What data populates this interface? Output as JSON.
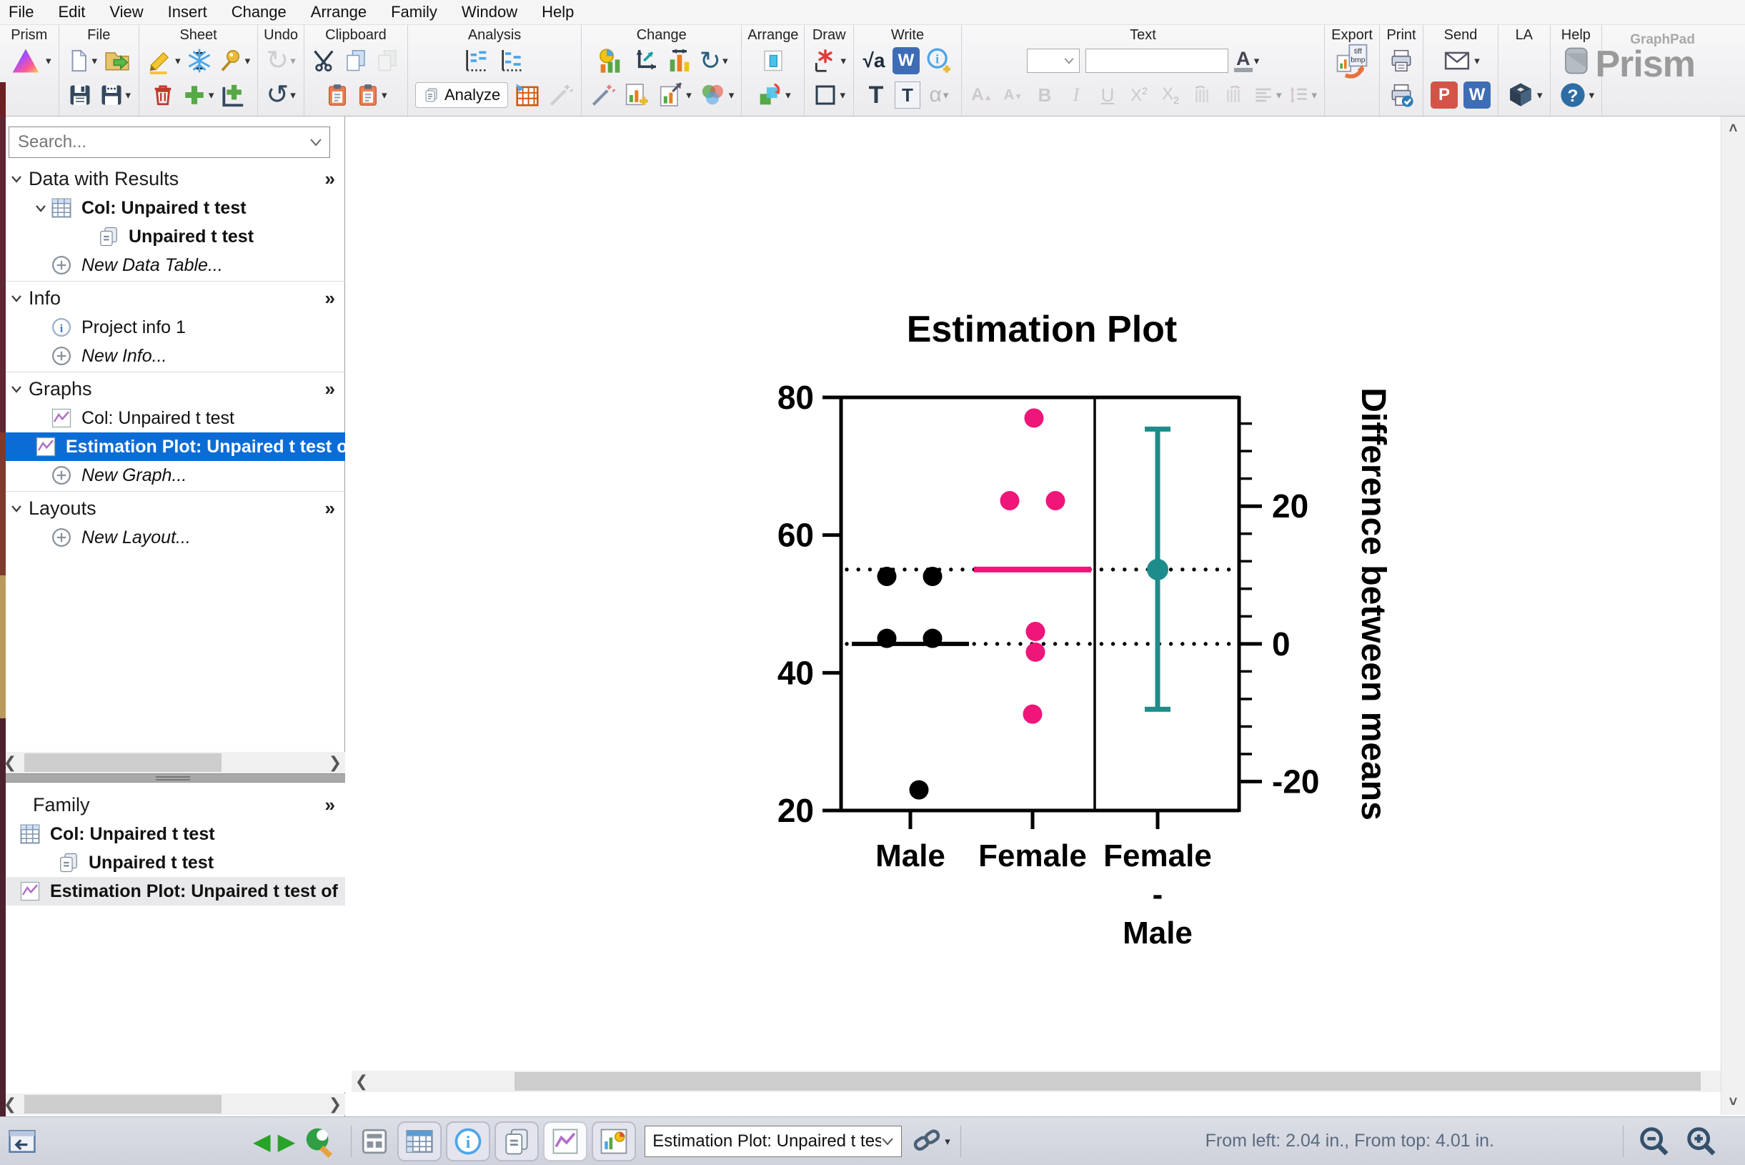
{
  "menu": {
    "items": [
      "File",
      "Edit",
      "View",
      "Insert",
      "Change",
      "Arrange",
      "Family",
      "Window",
      "Help"
    ]
  },
  "toolbar": {
    "sections": [
      {
        "label": "Prism",
        "rows": [
          [
            {
              "k": "prism",
              "n": "prism-logo-icon",
              "dd": 1
            }
          ]
        ]
      },
      {
        "label": "File",
        "rows": [
          [
            {
              "k": "doc",
              "n": "new-file-icon",
              "dd": 1
            },
            {
              "k": "folder",
              "n": "open-file-icon"
            }
          ],
          [
            {
              "k": "disk",
              "n": "save-icon"
            },
            {
              "k": "disk2",
              "n": "save-as-icon",
              "dd": 1
            }
          ]
        ]
      },
      {
        "label": "Sheet",
        "rows": [
          [
            {
              "k": "pencil",
              "n": "highlight-sheet-icon",
              "dd": 1
            },
            {
              "k": "snow",
              "n": "freeze-sheet-icon"
            },
            {
              "k": "pin",
              "n": "pin-sheet-icon",
              "dd": 1
            }
          ],
          [
            {
              "k": "trash",
              "n": "delete-sheet-icon"
            },
            {
              "k": "plus",
              "n": "new-sheet-icon",
              "dd": 1
            },
            {
              "k": "plusaxis",
              "n": "new-graph-sheet-icon"
            }
          ]
        ]
      },
      {
        "label": "Undo",
        "rows": [
          [
            {
              "k": "redo",
              "n": "redo-icon",
              "dis": 1,
              "dd": 1
            }
          ],
          [
            {
              "k": "undo",
              "n": "undo-icon",
              "dd": 1
            }
          ]
        ]
      },
      {
        "label": "Clipboard",
        "rows": [
          [
            {
              "k": "scissors",
              "n": "cut-icon"
            },
            {
              "k": "pages",
              "n": "copy-icon"
            },
            {
              "k": "pastepages",
              "n": "paste-link-icon",
              "dis": 1
            }
          ],
          [
            {
              "k": "clip",
              "n": "paste-icon"
            },
            {
              "k": "clip",
              "n": "paste-special-icon",
              "dd": 1
            }
          ]
        ]
      },
      {
        "label": "Analysis",
        "rows": [
          [
            {
              "k": "plot",
              "n": "ttest-analysis-icon"
            },
            {
              "k": "plot2",
              "n": "ttest-analysis-2-icon"
            }
          ],
          [
            {
              "k": "analyze",
              "n": "analyze-button",
              "t": "Analyze"
            },
            {
              "k": "table",
              "n": "analysis-table-icon"
            },
            {
              "k": "wand",
              "n": "analysis-wizard-icon",
              "dis": 1
            }
          ]
        ]
      },
      {
        "label": "Change",
        "rows": [
          [
            {
              "k": "piebar",
              "n": "change-graph-type-icon"
            },
            {
              "k": "axes",
              "n": "change-axes-icon"
            },
            {
              "k": "barsarr",
              "n": "change-order-icon"
            },
            {
              "k": "rotate",
              "n": "rotate-graph-icon",
              "dd": 1
            }
          ],
          [
            {
              "k": "wand2",
              "n": "magic-wand-icon"
            },
            {
              "k": "chartadd",
              "n": "add-plot-icon"
            },
            {
              "k": "chartsize",
              "n": "resize-graph-icon",
              "dd": 1
            },
            {
              "k": "venn",
              "n": "color-scheme-icon",
              "dd": 1
            }
          ]
        ]
      },
      {
        "label": "Arrange",
        "rows": [
          [
            {
              "k": "rect",
              "n": "selection-tool-icon"
            }
          ],
          [
            {
              "k": "shapes",
              "n": "arrange-objects-icon",
              "dd": 1
            }
          ]
        ]
      },
      {
        "label": "Draw",
        "rows": [
          [
            {
              "k": "star",
              "n": "draw-points-icon",
              "dd": 1
            }
          ],
          [
            {
              "k": "square",
              "n": "draw-shape-icon",
              "dd": 1
            }
          ]
        ]
      },
      {
        "label": "Write",
        "rows": [
          [
            {
              "k": "sqrta",
              "n": "equation-icon",
              "g": "√a"
            },
            {
              "k": "wbox",
              "n": "word-notes-icon",
              "g": "W"
            },
            {
              "k": "infoadd",
              "n": "new-info-icon"
            }
          ],
          [
            {
              "k": "T",
              "n": "text-tool-icon",
              "g": "T"
            },
            {
              "k": "Tbox",
              "n": "text-box-icon",
              "g": "T"
            },
            {
              "k": "alpha",
              "n": "greek-char-icon",
              "g": "α",
              "dis": 1,
              "dd": 1
            }
          ]
        ]
      },
      {
        "label": "Text",
        "rows": [
          [
            {
              "k": "combo",
              "n": "font-size-combo"
            },
            {
              "k": "combow",
              "n": "font-name-combo"
            },
            {
              "k": "Acolor",
              "n": "font-color-icon",
              "g": "A",
              "dd": 1
            }
          ],
          [
            {
              "k": "Aup",
              "n": "increase-font-icon",
              "g": "A",
              "dis": 1
            },
            {
              "k": "Adown",
              "n": "decrease-font-icon",
              "g": "A",
              "dis": 1
            },
            {
              "k": "Bold",
              "n": "bold-icon",
              "g": "B",
              "dis": 1
            },
            {
              "k": "Italic",
              "n": "italic-icon",
              "g": "I",
              "dis": 1
            },
            {
              "k": "Under",
              "n": "underline-icon",
              "g": "U",
              "dis": 1
            },
            {
              "k": "Xsup",
              "n": "superscript-icon",
              "g": "X",
              "dis": 1
            },
            {
              "k": "Xsub",
              "n": "subscript-icon",
              "g": "X",
              "dis": 1
            },
            {
              "k": "ind1",
              "n": "rotate-text-left-icon",
              "dis": 1
            },
            {
              "k": "ind2",
              "n": "rotate-text-right-icon",
              "dis": 1
            },
            {
              "k": "align",
              "n": "align-text-icon",
              "dis": 1,
              "dd": 1
            },
            {
              "k": "lspace",
              "n": "line-spacing-icon",
              "dis": 1,
              "dd": 1
            }
          ]
        ]
      },
      {
        "label": "Export",
        "rows": [
          [
            {
              "k": "export",
              "n": "export-image-icon",
              "t1": "tiff",
              "t2": "bmp"
            }
          ]
        ]
      },
      {
        "label": "Print",
        "rows": [
          [
            {
              "k": "print",
              "n": "print-icon"
            }
          ],
          [
            {
              "k": "printck",
              "n": "print-preview-icon"
            }
          ]
        ]
      },
      {
        "label": "Send",
        "rows": [
          [
            {
              "k": "mail",
              "n": "email-icon",
              "dd": 1
            }
          ],
          [
            {
              "k": "pbox",
              "n": "send-to-powerpoint-icon",
              "g": "P"
            },
            {
              "k": "wbox",
              "n": "send-to-word-icon",
              "g": "W"
            }
          ]
        ]
      },
      {
        "label": "LA",
        "rows": [
          [],
          [
            {
              "k": "cube",
              "n": "layout-assistant-icon",
              "dd": 1
            }
          ]
        ]
      },
      {
        "label": "Help",
        "rows": [
          [
            {
              "k": "graysq",
              "n": "prism-guides-icon"
            }
          ],
          [
            {
              "k": "help",
              "n": "help-icon",
              "g": "?",
              "dd": 1
            }
          ]
        ]
      }
    ],
    "logo": {
      "brand": "GraphPad",
      "name": "Prism"
    }
  },
  "sidebar": {
    "search_placeholder": "Search...",
    "sections": [
      {
        "label": "Data with Results",
        "expander": "»",
        "items": [
          {
            "label": "Col: Unpaired t test",
            "icon": "table-icon",
            "bold": true,
            "chevron": true,
            "indent": 1
          },
          {
            "label": "Unpaired t test",
            "icon": "results-icon",
            "bold": true,
            "indent": 2
          },
          {
            "label": "New Data Table...",
            "icon": "plus-circle-icon",
            "italic": true,
            "indent": 0
          }
        ]
      },
      {
        "label": "Info",
        "expander": "»",
        "items": [
          {
            "label": "Project info 1",
            "icon": "info-icon",
            "indent": 1
          },
          {
            "label": "New Info...",
            "icon": "plus-circle-icon",
            "italic": true,
            "indent": 0
          }
        ]
      },
      {
        "label": "Graphs",
        "expander": "»",
        "items": [
          {
            "label": "Col: Unpaired t test",
            "icon": "graph-icon",
            "indent": 1
          },
          {
            "label": "Estimation Plot: Unpaired t test of",
            "icon": "graph-icon",
            "bold": true,
            "selected": true,
            "indent": 1
          },
          {
            "label": "New Graph...",
            "icon": "plus-circle-icon",
            "italic": true,
            "indent": 0
          }
        ]
      },
      {
        "label": "Layouts",
        "expander": "»",
        "items": [
          {
            "label": "New Layout...",
            "icon": "plus-circle-icon",
            "italic": true,
            "indent": 0
          }
        ]
      }
    ],
    "family": {
      "label": "Family",
      "expander": "»",
      "items": [
        {
          "label": "Col: Unpaired t test",
          "icon": "table-icon",
          "bold": true,
          "indent": 0
        },
        {
          "label": "Unpaired t test",
          "icon": "results-icon",
          "bold": true,
          "indent": 1
        },
        {
          "label": "Estimation Plot: Unpaired t test of",
          "icon": "graph-icon",
          "bold": true,
          "highlight": true,
          "indent": 0
        }
      ]
    }
  },
  "statusbar": {
    "collapse": {
      "n": "collapse-navigator-icon"
    },
    "nav": [
      {
        "k": "prev",
        "n": "previous-sheet-icon"
      },
      {
        "k": "next",
        "n": "next-sheet-icon"
      },
      {
        "k": "gosheet",
        "n": "go-to-linked-sheet-icon"
      }
    ],
    "gallery": {
      "n": "gallery-view-icon"
    },
    "views": [
      {
        "k": "vtable",
        "n": "view-data-tables-icon"
      },
      {
        "k": "vinfo",
        "n": "view-info-icon"
      },
      {
        "k": "vresults",
        "n": "view-results-icon"
      },
      {
        "k": "vgraph",
        "n": "view-graphs-icon",
        "active": true
      },
      {
        "k": "vlayout",
        "n": "view-layouts-icon"
      }
    ],
    "sheet_selector": "Estimation Plot: Unpaired t test",
    "link": {
      "n": "linked-sheets-icon"
    },
    "position_text": "From left: 2.04 in., From top: 4.01 in.",
    "zoom": [
      {
        "k": "zoomout",
        "n": "zoom-out-icon"
      },
      {
        "k": "zoomin",
        "n": "zoom-in-icon"
      }
    ]
  },
  "chart_data": {
    "type": "scatter",
    "subtype": "estimation-plot",
    "title": "Estimation Plot",
    "groups": [
      {
        "name": "Male",
        "color": "#000000",
        "values": [
          54,
          54,
          45,
          45,
          23
        ],
        "x_offsets": [
          -33,
          31,
          -33,
          31,
          12
        ],
        "mean": 44.2
      },
      {
        "name": "Female",
        "color": "#F01579",
        "values": [
          77,
          65,
          65,
          46,
          43,
          34
        ],
        "x_offsets": [
          2,
          -32,
          32,
          4,
          4,
          0
        ],
        "mean": 55.0
      }
    ],
    "difference": {
      "label_lines": [
        "Female",
        "-",
        "Male"
      ],
      "mean": 10.8,
      "ci_low": -9.5,
      "ci_high": 31.2,
      "color": "#1F8C8C"
    },
    "left_axis": {
      "min": 20,
      "max": 80,
      "major_ticks": [
        20,
        40,
        60,
        80
      ]
    },
    "right_axis": {
      "label": "Difference between means",
      "major_ticks": [
        -20,
        0,
        20
      ],
      "minor_step": 4,
      "min": -25,
      "max": 33,
      "zero_at_left_value": 44.2
    },
    "dotted_lines_at_left_values": [
      55,
      44.2
    ],
    "grid": "off",
    "legend": "none"
  },
  "colors": {
    "accent_selection": "#0c6cd6",
    "pink": "#F01579",
    "teal": "#1F8C8C",
    "statusbar_bg": "#d5d7de"
  }
}
